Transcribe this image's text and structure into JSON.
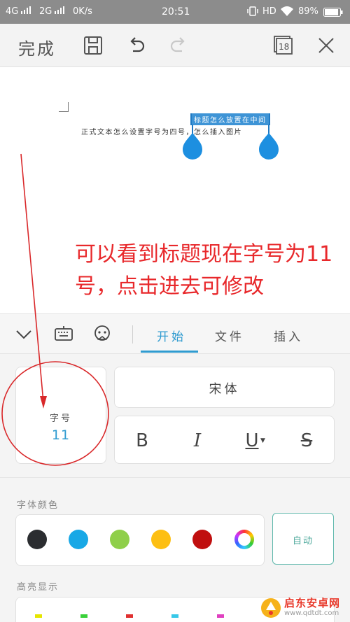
{
  "status_bar": {
    "sim1": "4G",
    "sim2": "2G",
    "speed": "0K/s",
    "time": "20:51",
    "network": "HD",
    "battery": "89%"
  },
  "toolbar": {
    "done_label": "完成",
    "pages_count": "18"
  },
  "document": {
    "body_text": "正式文本怎么设置字号为四号，怎么插入图片",
    "selected_text": "标题怎么放置在中间"
  },
  "annotation": {
    "line1": "可以看到标题现在字号为11",
    "line2": "号，点击进去可修改"
  },
  "tabs": [
    {
      "label": "开始",
      "active": true
    },
    {
      "label": "文件",
      "active": false
    },
    {
      "label": "插入",
      "active": false
    }
  ],
  "format": {
    "size_label": "字号",
    "size_value": "11",
    "font_name": "宋体",
    "bold_label": "B",
    "italic_label": "I",
    "underline_label": "U",
    "strike_label": "S"
  },
  "font_color": {
    "label": "字体颜色",
    "swatches": [
      "#2b2d30",
      "#18a8e6",
      "#8fcf4a",
      "#fdbf12",
      "#c00f0f"
    ],
    "auto_label": "自动"
  },
  "highlight": {
    "label": "高亮显示"
  },
  "watermark": {
    "title": "启东安卓网",
    "url": "www.qdtdt.com"
  },
  "colors": {
    "accent": "#2f9bd0",
    "annotation": "#e8282b",
    "selection": "#3e94d6"
  }
}
